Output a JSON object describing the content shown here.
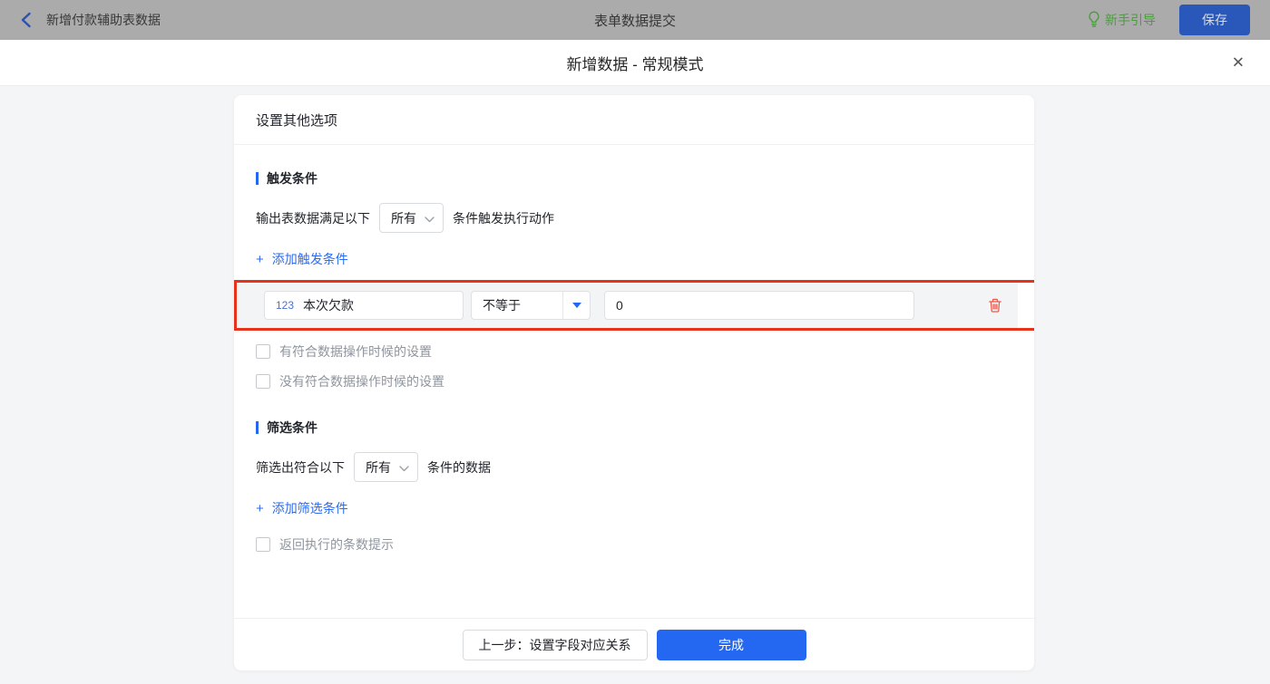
{
  "topbar": {
    "back_label": "新增付款辅助表数据",
    "center_title": "表单数据提交",
    "guide_label": "新手引导",
    "save_label": "保存"
  },
  "dialog": {
    "title": "新增数据 - 常规模式",
    "close_glyph": "✕"
  },
  "panel": {
    "header": "设置其他选项"
  },
  "trigger": {
    "title": "触发条件",
    "prefix": "输出表数据满足以下",
    "match_mode": "所有",
    "suffix": "条件触发执行动作",
    "add_icon": "+",
    "add_label": "添加触发条件",
    "condition": {
      "type_badge": "123",
      "field": "本次欠款",
      "operator": "不等于",
      "value": "0"
    },
    "checkbox_has_match": "有符合数据操作时候的设置",
    "checkbox_no_match": "没有符合数据操作时候的设置"
  },
  "filter": {
    "title": "筛选条件",
    "prefix": "筛选出符合以下",
    "match_mode": "所有",
    "suffix": "条件的数据",
    "add_icon": "+",
    "add_label": "添加筛选条件",
    "checkbox_count_tip": "返回执行的条数提示"
  },
  "footer": {
    "prev_label": "上一步：设置字段对应关系",
    "done_label": "完成"
  },
  "colors": {
    "accent_blue": "#2468f2",
    "link_blue": "#2e6bf2",
    "highlight_red": "#e8331c",
    "trash_red": "#f0564a",
    "guide_green": "#4d9b41",
    "topbar_bg": "#ababab",
    "save_button_bg": "#2a57ba"
  }
}
